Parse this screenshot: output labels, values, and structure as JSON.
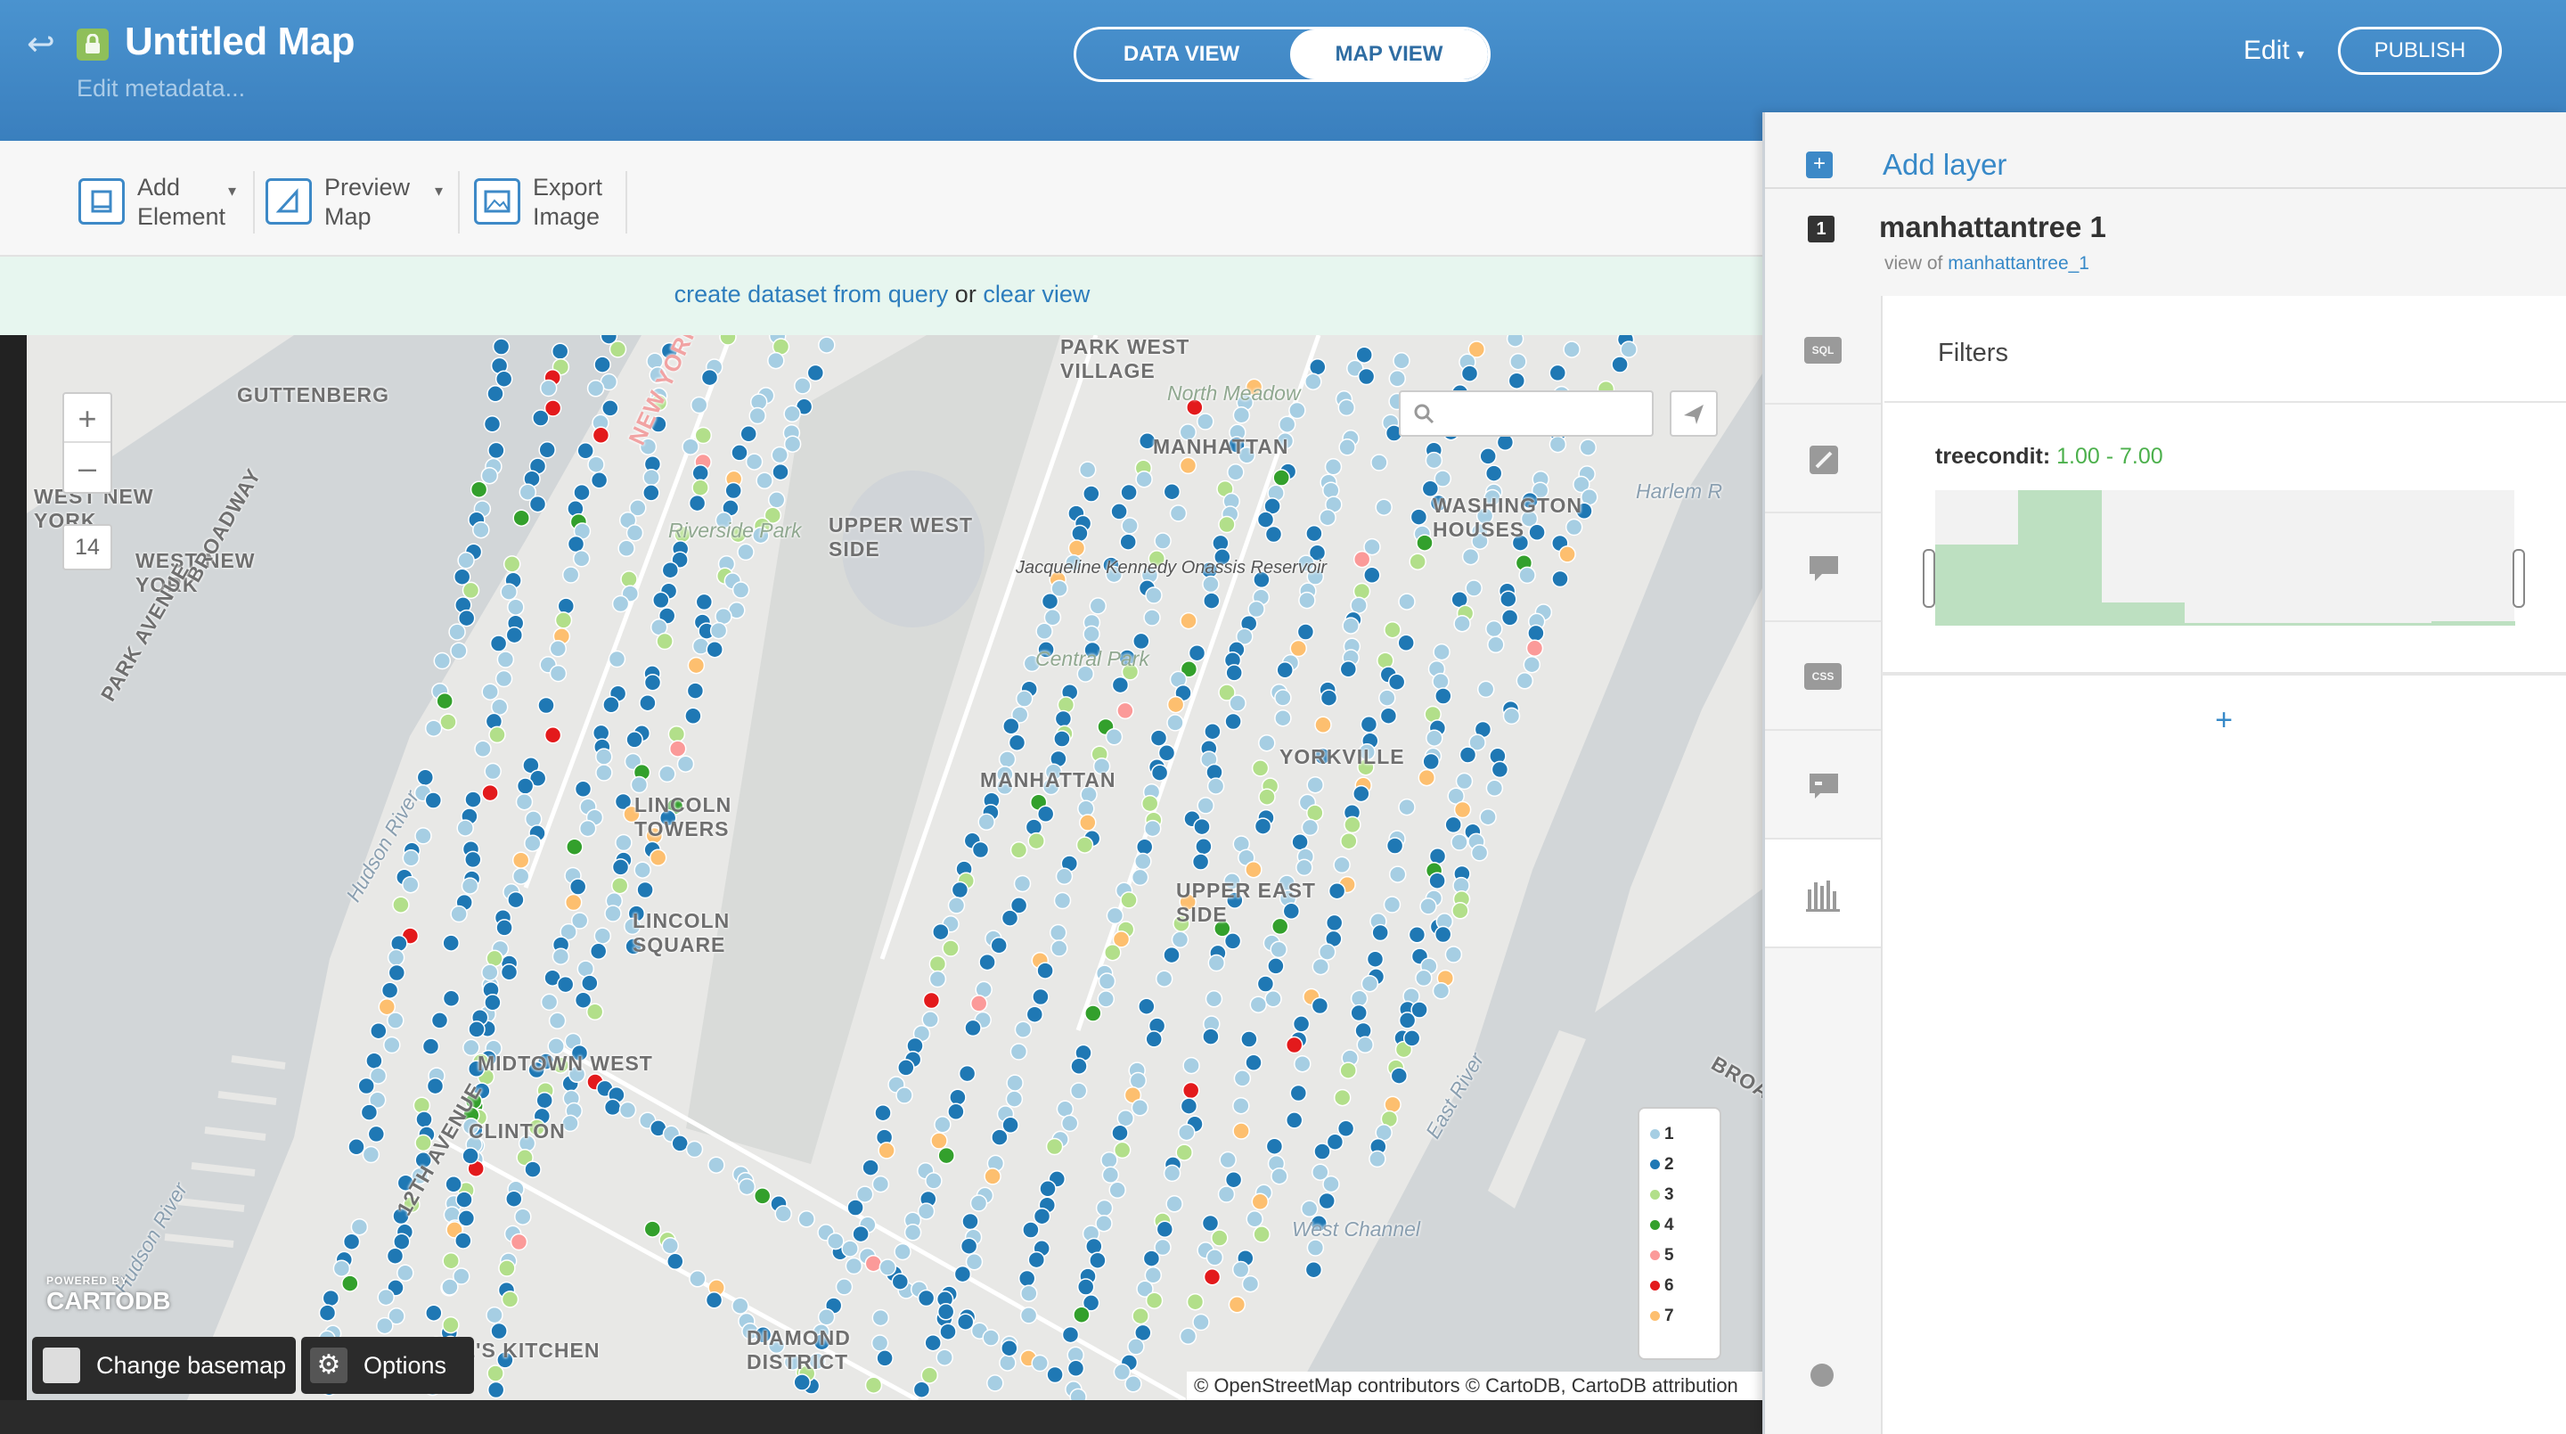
{
  "header": {
    "title": "Untitled Map",
    "subtitle": "Edit metadata...",
    "view_toggle": {
      "data_view": "DATA VIEW",
      "map_view": "MAP VIEW",
      "active": "MAP VIEW"
    },
    "edit_menu": "Edit",
    "publish": "PUBLISH"
  },
  "toolbar": {
    "add_element": "Add\nElement",
    "preview_map": "Preview\nMap",
    "export_image": "Export\nImage"
  },
  "infobar": {
    "link1": "create dataset from query",
    "or": " or ",
    "link2": "clear view"
  },
  "map": {
    "zoom_in": "+",
    "zoom_out": "–",
    "zoom_level": "14",
    "search_placeholder": "",
    "labels": {
      "guttenberg": "GUTTENBERG",
      "west_new_york_1": "WEST NEW\nYORK",
      "west_new_york_2": "WEST NEW\nYORK",
      "broadway": "BROADWAY",
      "park_avenue": "PARK AVENUE",
      "new_york": "NEW YORK",
      "hudson_river": "Hudson River",
      "riverside_park": "Riverside Park",
      "upper_west_side": "UPPER WEST\nSIDE",
      "park_west_village": "PARK WEST\nVILLAGE",
      "north_meadow": "North Meadow",
      "manhattan_top": "MANHATTAN",
      "jackie_reservoir": "Jacqueline Kennedy Onassis Reservoir",
      "central_park": "Central Park",
      "manhattan_mid": "MANHATTAN",
      "washington_houses": "WASHINGTON\nHOUSES",
      "harlem_river": "Harlem R",
      "yorkville": "YORKVILLE",
      "lincoln_towers": "LINCOLN\nTOWERS",
      "lincoln_square": "LINCOLN\nSQUARE",
      "upper_east_side": "UPPER EAST\nSIDE",
      "midtown_west": "MIDTOWN WEST",
      "clinton": "CLINTON",
      "twelfth_avenue": "12TH AVENUE",
      "east_river": "East River",
      "west_channel": "West Channel",
      "hells_kitchen": "HELL'S KITCHEN",
      "diamond_district": "DIAMOND\nDISTRICT",
      "broa": "BROA",
      "hudson_river_2": "Hudson River"
    },
    "legend": [
      "1",
      "2",
      "3",
      "4",
      "5",
      "6",
      "7"
    ],
    "legend_colors": [
      "#a6cee3",
      "#1f78b4",
      "#b2df8a",
      "#33a02c",
      "#fb9a99",
      "#e31a1c",
      "#fdbf6f"
    ],
    "change_basemap": "Change basemap",
    "options": "Options",
    "attribution": "© OpenStreetMap contributors © CartoDB, CartoDB attribution",
    "powered_by": "POWERED BY",
    "cartodb": "CARTODB"
  },
  "panel": {
    "add_layer": "Add layer",
    "layer_number": "1",
    "layer_name": "manhattantree 1",
    "view_of_prefix": "view of ",
    "view_of_link": "manhattantree_1",
    "tabs": [
      "SQL",
      "wizard",
      "infowindow",
      "CSS",
      "legend",
      "filters"
    ],
    "filters_title": "Filters",
    "filter": {
      "column": "treecondit:",
      "range": "1.00 - 7.00",
      "histogram": [
        0.6,
        1.0,
        0.17,
        0.02,
        0.02,
        0.02,
        0.03
      ]
    },
    "add_filter": "+"
  }
}
